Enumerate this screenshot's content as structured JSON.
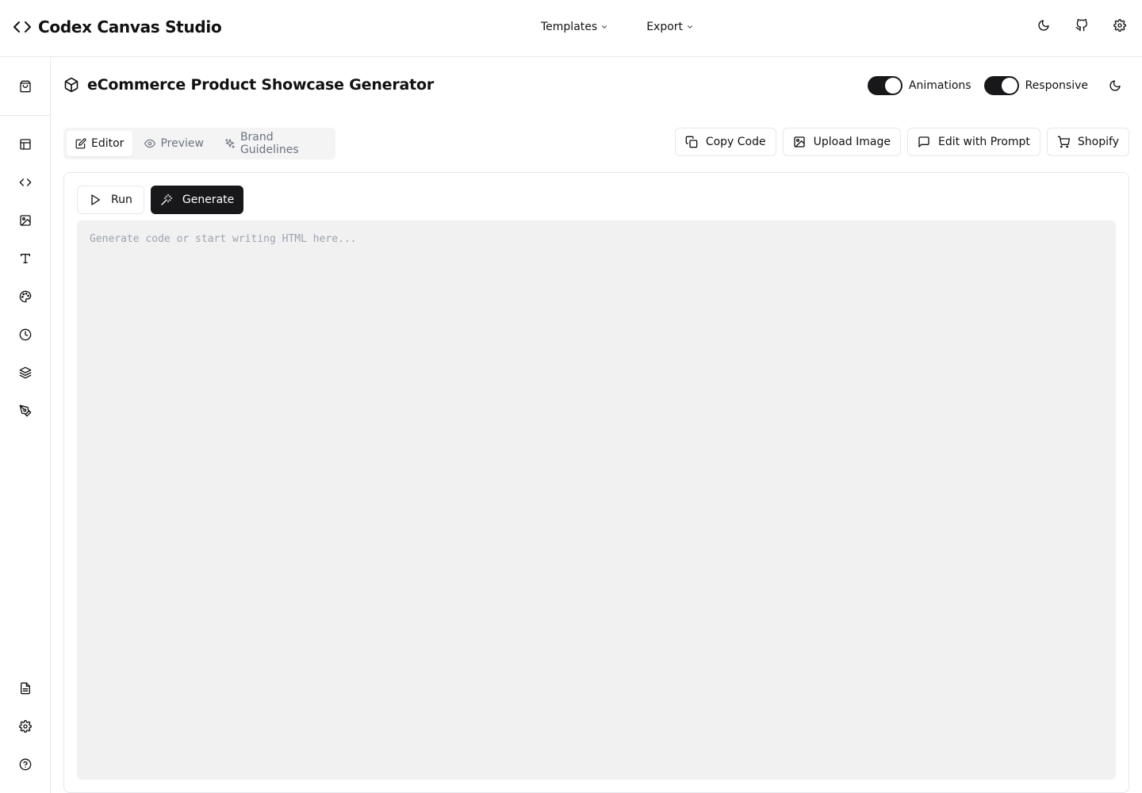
{
  "app": {
    "title": "Codex Canvas Studio",
    "logo_icon": "code-brackets-icon"
  },
  "topnav": {
    "items": [
      {
        "label": "Templates",
        "icon": "chevron-down-icon"
      },
      {
        "label": "Export",
        "icon": "chevron-down-icon"
      }
    ],
    "right_icons": [
      "moon-icon",
      "github-icon",
      "gear-icon"
    ]
  },
  "sidebar": {
    "top_icon": "shopping-bag-icon",
    "items": [
      "layout-icon",
      "code-icon",
      "image-icon",
      "type-icon",
      "palette-icon",
      "clock-icon",
      "layers-icon",
      "pen-tool-icon"
    ],
    "bottom_items": [
      "file-text-icon",
      "gear-icon",
      "help-circle-icon"
    ]
  },
  "header": {
    "title": "eCommerce Product Showcase Generator",
    "icon": "box-icon",
    "toggles": [
      {
        "label": "Animations",
        "on": true
      },
      {
        "label": "Responsive",
        "on": true
      }
    ],
    "theme_icon": "moon-icon"
  },
  "tabs": [
    {
      "label": "Editor",
      "icon": "edit-icon",
      "active": true
    },
    {
      "label": "Preview",
      "icon": "eye-icon",
      "active": false
    },
    {
      "label": "Brand Guidelines",
      "icon": "sparkles-icon",
      "active": false
    }
  ],
  "actions": [
    {
      "label": "Copy Code",
      "icon": "copy-icon"
    },
    {
      "label": "Upload Image",
      "icon": "image-icon"
    },
    {
      "label": "Edit with Prompt",
      "icon": "message-square-icon"
    },
    {
      "label": "Shopify",
      "icon": "shopping-cart-icon"
    }
  ],
  "editor": {
    "run_label": "Run",
    "generate_label": "Generate",
    "placeholder": "Generate code or start writing HTML here...",
    "value": ""
  },
  "colors": {
    "accent": "#18181b",
    "border": "#e5e7eb",
    "editor_bg": "#f1f1f1",
    "muted_text": "#6b7280"
  }
}
